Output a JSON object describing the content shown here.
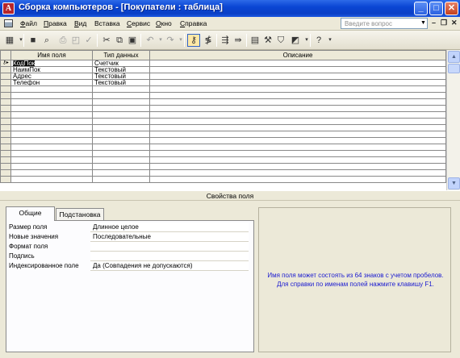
{
  "window": {
    "app_icon_letter": "A",
    "title": "Сборка компьютеров - [Покупатели : таблица]",
    "buttons": {
      "minimize": "_",
      "maximize": "□",
      "close": "✕"
    }
  },
  "menubar": {
    "items": [
      {
        "key": "Ф",
        "rest": "айл"
      },
      {
        "key": "П",
        "rest": "равка"
      },
      {
        "key": "В",
        "rest": "ид"
      },
      {
        "key": "",
        "rest": "Вставка"
      },
      {
        "key": "С",
        "rest": "ервис"
      },
      {
        "key": "О",
        "rest": "кно"
      },
      {
        "key": "С",
        "rest": "правка"
      }
    ],
    "help_placeholder": "Введите вопрос",
    "mdi": {
      "minimize": "–",
      "restore": "❐",
      "close": "✕"
    }
  },
  "toolbar": {
    "icons": [
      "view-icon",
      "save-icon",
      "search-icon",
      "print-icon",
      "preview-icon",
      "spelling-icon",
      "cut-icon",
      "copy-icon",
      "paste-icon",
      "undo-icon",
      "redo-icon",
      "primary-key-icon",
      "indexes-icon",
      "insert-rows-icon",
      "delete-rows-icon",
      "properties-icon",
      "build-icon",
      "database-window-icon",
      "new-object-icon",
      "help-icon"
    ]
  },
  "grid": {
    "columns": [
      "Имя поля",
      "Тип данных",
      "Описание"
    ],
    "rows": [
      {
        "name": "КодПок",
        "type": "Счетчик",
        "description": "",
        "key": true
      },
      {
        "name": "НаимПок",
        "type": "Текстовый",
        "description": ""
      },
      {
        "name": "Адрес",
        "type": "Текстовый",
        "description": ""
      },
      {
        "name": "Телефон",
        "type": "Текстовый",
        "description": ""
      }
    ]
  },
  "properties": {
    "header": "Свойства поля",
    "tabs": [
      "Общие",
      "Подстановка"
    ],
    "rows": [
      {
        "label": "Размер поля",
        "value": "Длинное целое"
      },
      {
        "label": "Новые значения",
        "value": "Последовательные"
      },
      {
        "label": "Формат поля",
        "value": ""
      },
      {
        "label": "Подпись",
        "value": ""
      },
      {
        "label": "Индексированное поле",
        "value": "Да (Совпадения не допускаются)"
      }
    ],
    "hint_line1": "Имя поля может состоять из 64 знаков с учетом пробелов.",
    "hint_line2": "Для справки по именам полей нажмите клавишу F1."
  }
}
